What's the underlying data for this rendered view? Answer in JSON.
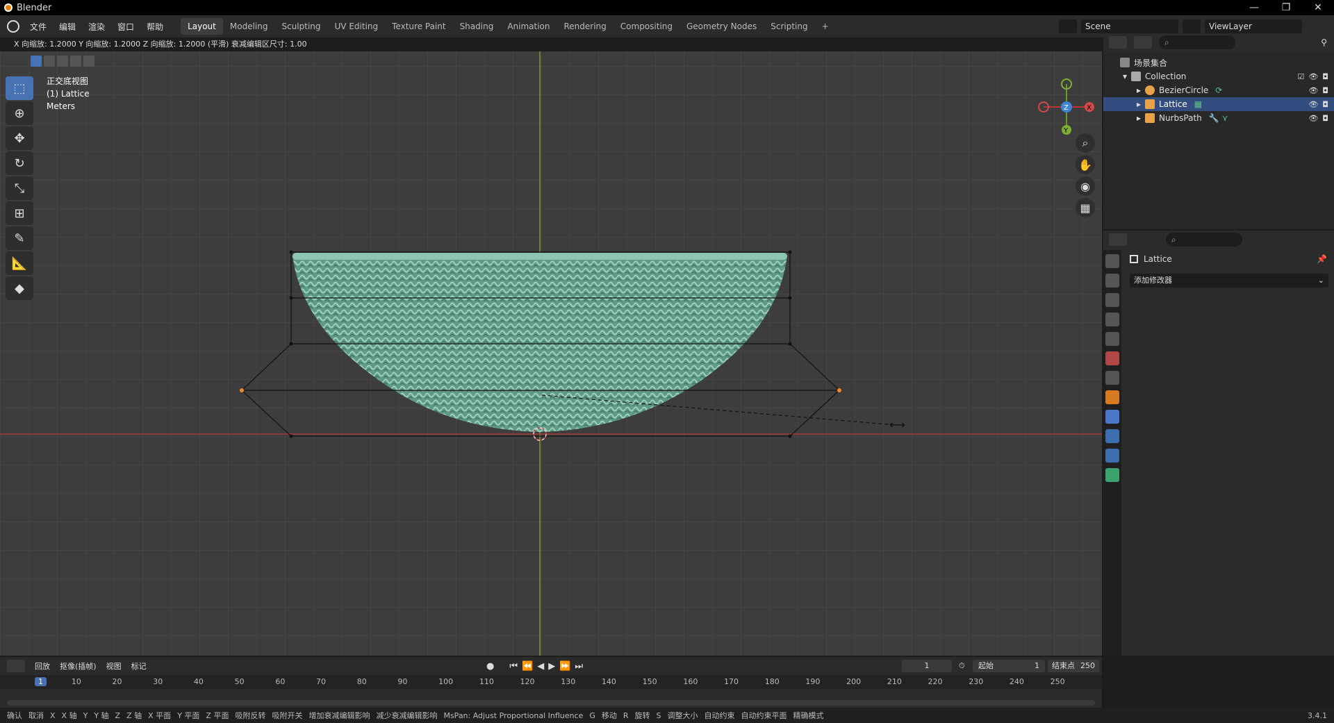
{
  "window": {
    "title": "Blender",
    "controls": [
      "—",
      "❐",
      "✕"
    ]
  },
  "menu": [
    "文件",
    "编辑",
    "渲染",
    "窗口",
    "帮助"
  ],
  "workspaces": [
    "Layout",
    "Modeling",
    "Sculpting",
    "UV Editing",
    "Texture Paint",
    "Shading",
    "Animation",
    "Rendering",
    "Compositing",
    "Geometry Nodes",
    "Scripting",
    "+"
  ],
  "active_workspace": "Layout",
  "scene": {
    "label": "Scene",
    "viewlayer": "ViewLayer"
  },
  "viewport": {
    "header_text": "X 向缩放: 1.2000   Y 向缩放: 1.2000  Z 向缩放: 1.2000 (平滑) 衰减编辑区尺寸: 1.00",
    "overlay": [
      "正交底视图",
      "(1) Lattice",
      "Meters"
    ],
    "gizmo": {
      "z": "Z",
      "x": "X",
      "y": "Y"
    }
  },
  "outliner": {
    "root": "场景集合",
    "collection": "Collection",
    "items": [
      {
        "name": "BezierCircle",
        "color": "#e8a24a"
      },
      {
        "name": "Lattice",
        "color": "#e8a24a"
      },
      {
        "name": "NurbsPath",
        "color": "#e8a24a"
      }
    ]
  },
  "properties": {
    "object": "Lattice",
    "add_modifier": "添加修改器"
  },
  "timeline": {
    "menus": [
      "回放",
      "抠像(插帧)",
      "视图",
      "标记"
    ],
    "current_frame": "1",
    "start_label": "起始",
    "start": "1",
    "end_label": "结束点",
    "end": "250",
    "ticks": [
      "1",
      "10",
      "20",
      "30",
      "40",
      "50",
      "60",
      "70",
      "80",
      "90",
      "100",
      "110",
      "120",
      "130",
      "140",
      "150",
      "160",
      "170",
      "180",
      "190",
      "200",
      "210",
      "220",
      "230",
      "240",
      "250"
    ]
  },
  "status": {
    "items": [
      "确认",
      "取消",
      "X",
      "X 轴",
      "Y",
      "Y 轴",
      "Z",
      "Z 轴",
      "X 平面",
      "Y 平面",
      "Z 平面",
      "吸附反转",
      "吸附开关",
      "增加衰减编辑影响",
      "减少衰减编辑影响",
      "MsPan: Adjust Proportional Influence",
      "G",
      "移动",
      "R",
      "旋转",
      "S",
      "调整大小",
      "自动约束",
      "自动约束平面",
      "精确模式"
    ],
    "version": "3.4.1"
  }
}
